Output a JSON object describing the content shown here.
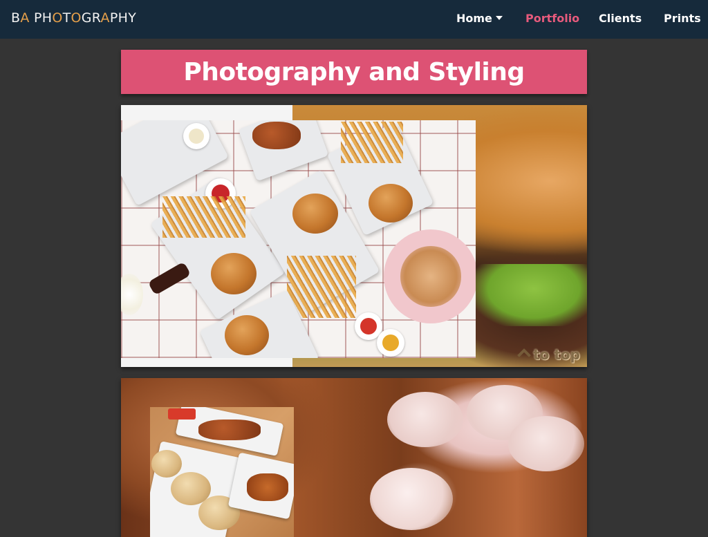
{
  "navbar": {
    "brand_parts": [
      {
        "text": "B",
        "accent": false
      },
      {
        "text": "A",
        "accent": true
      },
      {
        "text": " PH",
        "accent": false
      },
      {
        "text": "O",
        "accent": true
      },
      {
        "text": "T",
        "accent": false
      },
      {
        "text": "O",
        "accent": true
      },
      {
        "text": "GR",
        "accent": false
      },
      {
        "text": "A",
        "accent": true
      },
      {
        "text": "PHY",
        "accent": false
      }
    ],
    "items": [
      {
        "label": "Home",
        "dropdown": true,
        "active": false
      },
      {
        "label": "Portfolio",
        "dropdown": false,
        "active": true
      },
      {
        "label": "Clients",
        "dropdown": false,
        "active": false
      },
      {
        "label": "Prints",
        "dropdown": false,
        "active": false
      }
    ]
  },
  "page": {
    "title": "Photography and Styling",
    "to_top_label": "to top"
  },
  "colors": {
    "navbar_bg": "#162a3b",
    "page_bg": "#343434",
    "accent_pink": "#dd5274",
    "brand_accent": "#e6a04a"
  },
  "photos": [
    {
      "subject": "burger-and-fries-flatlay"
    },
    {
      "subject": "dim-sum"
    }
  ]
}
